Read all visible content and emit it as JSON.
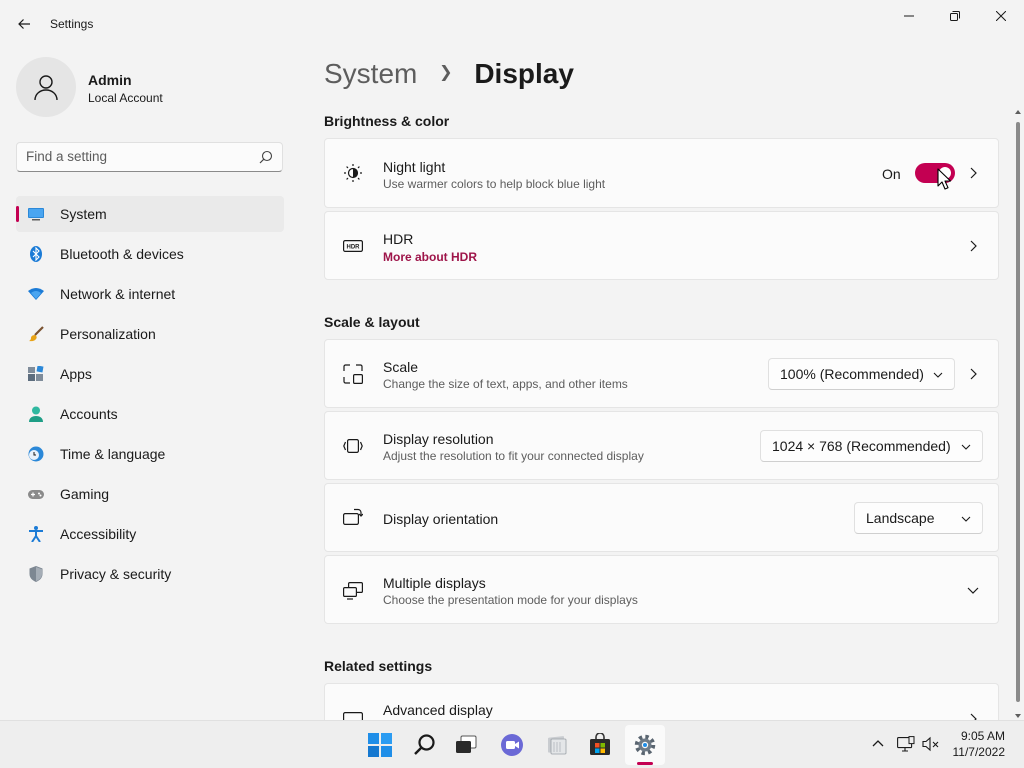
{
  "window": {
    "title": "Settings"
  },
  "user": {
    "name": "Admin",
    "account_type": "Local Account"
  },
  "search": {
    "placeholder": "Find a setting"
  },
  "sidebar": {
    "items": [
      {
        "label": "System",
        "icon": "monitor-icon",
        "active": true
      },
      {
        "label": "Bluetooth & devices",
        "icon": "bluetooth-icon"
      },
      {
        "label": "Network & internet",
        "icon": "wifi-icon"
      },
      {
        "label": "Personalization",
        "icon": "brush-icon"
      },
      {
        "label": "Apps",
        "icon": "apps-icon"
      },
      {
        "label": "Accounts",
        "icon": "person-icon"
      },
      {
        "label": "Time & language",
        "icon": "globe-clock-icon"
      },
      {
        "label": "Gaming",
        "icon": "gamepad-icon"
      },
      {
        "label": "Accessibility",
        "icon": "accessibility-icon"
      },
      {
        "label": "Privacy & security",
        "icon": "shield-icon"
      }
    ]
  },
  "breadcrumb": {
    "parent": "System",
    "current": "Display"
  },
  "sections": {
    "brightness": {
      "title": "Brightness & color",
      "night_light": {
        "title": "Night light",
        "desc": "Use warmer colors to help block blue light",
        "state": "On",
        "on": true
      },
      "hdr": {
        "title": "HDR",
        "link": "More about HDR"
      }
    },
    "scale_layout": {
      "title": "Scale & layout",
      "scale": {
        "title": "Scale",
        "desc": "Change the size of text, apps, and other items",
        "value": "100% (Recommended)"
      },
      "resolution": {
        "title": "Display resolution",
        "desc": "Adjust the resolution to fit your connected display",
        "value": "1024 × 768 (Recommended)"
      },
      "orientation": {
        "title": "Display orientation",
        "value": "Landscape"
      },
      "multiple": {
        "title": "Multiple displays",
        "desc": "Choose the presentation mode for your displays"
      }
    },
    "related": {
      "title": "Related settings",
      "advanced": {
        "title": "Advanced display"
      }
    }
  },
  "taskbar": {
    "apps": [
      "windows-start-icon",
      "search-icon",
      "task-view-icon",
      "chat-icon",
      "file-explorer-icon",
      "store-icon",
      "settings-icon"
    ],
    "time": "9:05 AM",
    "date": "11/7/2022"
  },
  "colors": {
    "accent": "#c30052",
    "link": "#9e1449",
    "background": "#f3f3f3",
    "card": "#fbfbfb"
  }
}
